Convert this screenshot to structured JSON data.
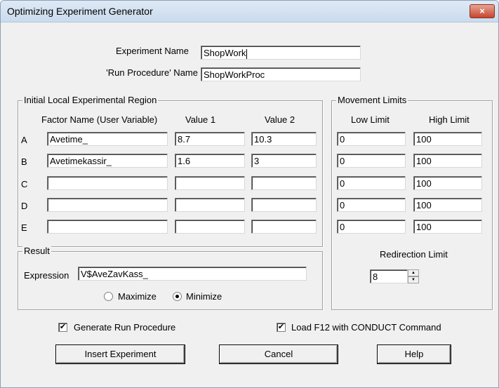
{
  "window": {
    "title": "Optimizing Experiment Generator",
    "close_glyph": "×"
  },
  "experiment": {
    "name_label": "Experiment Name",
    "name_value": "ShopWork",
    "proc_label": "'Run Procedure' Name",
    "proc_value": "ShopWorkProc"
  },
  "region": {
    "title": "Initial Local Experimental Region",
    "col_factor": "Factor Name (User Variable)",
    "col_value1": "Value 1",
    "col_value2": "Value 2",
    "rows": [
      {
        "letter": "A",
        "factor": "Avetime_",
        "value1": "8.7",
        "value2": "10.3"
      },
      {
        "letter": "B",
        "factor": "Avetimekassir_",
        "value1": "1.6",
        "value2": "3"
      },
      {
        "letter": "C",
        "factor": "",
        "value1": "",
        "value2": ""
      },
      {
        "letter": "D",
        "factor": "",
        "value1": "",
        "value2": ""
      },
      {
        "letter": "E",
        "factor": "",
        "value1": "",
        "value2": ""
      }
    ]
  },
  "limits": {
    "title": "Movement Limits",
    "col_low": "Low Limit",
    "col_high": "High Limit",
    "rows": [
      {
        "low": "0",
        "high": "100"
      },
      {
        "low": "0",
        "high": "100"
      },
      {
        "low": "0",
        "high": "100"
      },
      {
        "low": "0",
        "high": "100"
      },
      {
        "low": "0",
        "high": "100"
      }
    ],
    "redirection_label": "Redirection Limit",
    "redirection_value": "8"
  },
  "result": {
    "title": "Result",
    "expression_label": "Expression",
    "expression_value": "V$AveZavKass_",
    "maximize_label": "Maximize",
    "minimize_label": "Minimize",
    "selected": "Minimize"
  },
  "options": {
    "generate_label": "Generate Run Procedure",
    "generate_checked": true,
    "load_label": "Load F12 with CONDUCT Command",
    "load_checked": true
  },
  "buttons": {
    "insert": "Insert Experiment",
    "cancel": "Cancel",
    "help": "Help"
  },
  "icons": {
    "check": "✔",
    "spin_up": "▲",
    "spin_down": "▼"
  }
}
